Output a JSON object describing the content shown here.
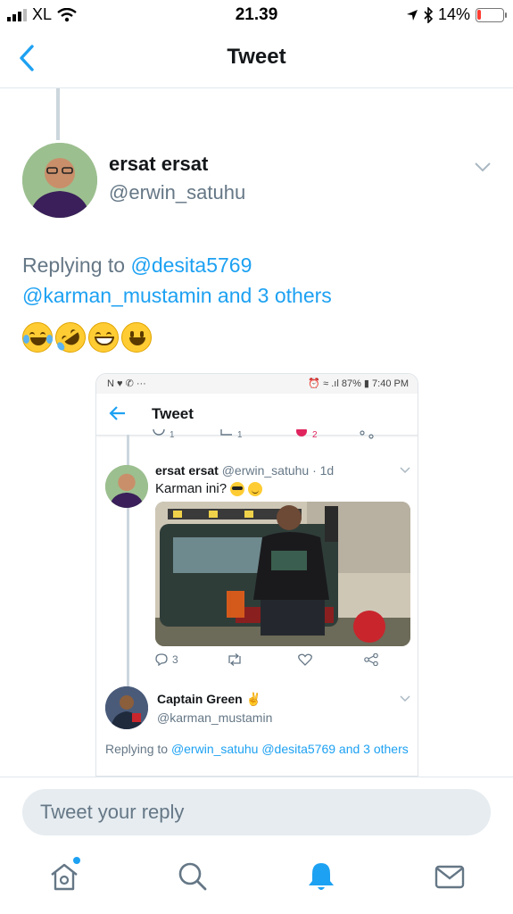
{
  "status_bar": {
    "carrier": "XL",
    "time": "21.39",
    "battery_percent": "14%",
    "battery_level": 0.14,
    "battery_color": "#ff3b30"
  },
  "header": {
    "title": "Tweet"
  },
  "tweet": {
    "author_name": "ersat ersat",
    "author_handle": "@erwin_satuhu",
    "replying_prefix": "Replying to ",
    "replying_handle_1": "@desita5769",
    "replying_handle_2": "@karman_mustamin",
    "replying_and": " and 3 others",
    "emojis": [
      "joy-emoji",
      "rofl-emoji",
      "grin-emoji",
      "grinning-emoji"
    ]
  },
  "embedded": {
    "status_left": "N ♥ ✆ ···",
    "status_right": "⏰ ≈ .ıl 87% ▮ 7:40 PM",
    "header_title": "Tweet",
    "prev_actions": {
      "replies": "1",
      "retweets": "1",
      "likes": "2"
    },
    "tweet": {
      "name": "ersat ersat",
      "handle_time": "@erwin_satuhu · 1d",
      "text": "Karman ini?",
      "replies": "3"
    },
    "reply": {
      "name": "Captain Green ✌",
      "handle": "@karman_mustamin",
      "replying_prefix": "Replying to ",
      "replying_handles": "@erwin_satuhu @desita5769 and 3 others"
    }
  },
  "reply_bar": {
    "placeholder": "Tweet your reply"
  },
  "accent_color": "#1da1f2"
}
